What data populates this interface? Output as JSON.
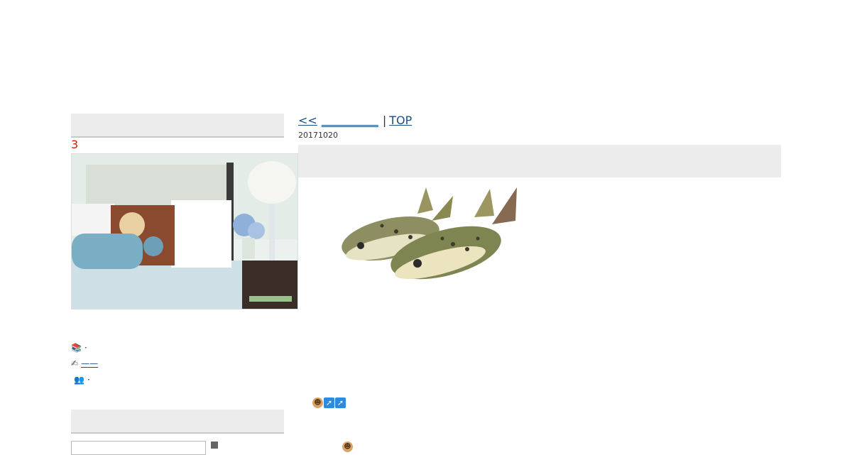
{
  "sidebar": {
    "profile_count": "3",
    "line1_text": "·",
    "line2_link": "——",
    "line3_text": "·",
    "icons": [
      "book-icon",
      "pen-icon",
      "people-icon"
    ]
  },
  "nav": {
    "prev_arrow": "<<",
    "prev_link": "__________",
    "separator": "|",
    "top_link": "TOP"
  },
  "post": {
    "date": "20171020"
  },
  "emoji": {
    "row1": [
      "grin-face-icon",
      "arrow-up-right-icon",
      "arrow-up-right-icon"
    ],
    "row2": [
      "face-icon"
    ]
  },
  "colors": {
    "panel_bg": "#ececec",
    "link": "#1a4f8a",
    "count_red": "#cc2200"
  }
}
